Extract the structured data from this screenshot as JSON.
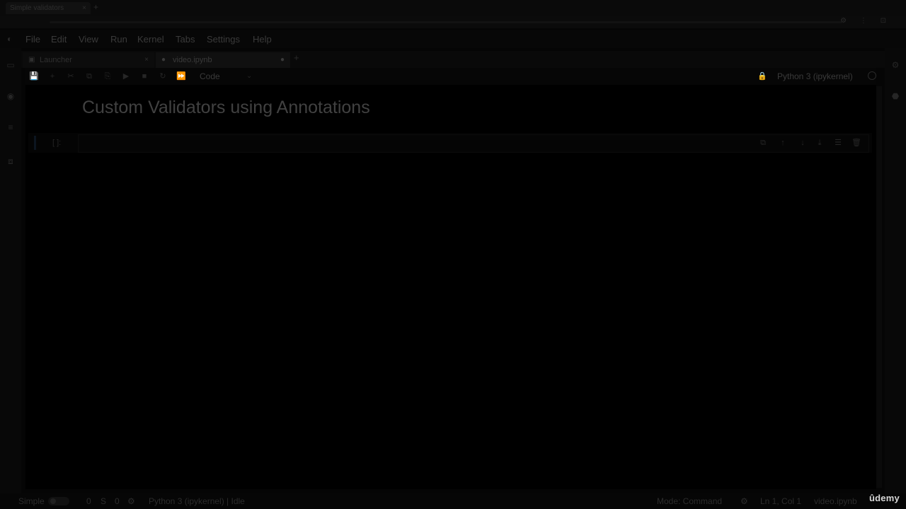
{
  "browser": {
    "tab_title": "Simple validators",
    "tab_close": "×",
    "new_tab": "+",
    "window_controls": "⚙ ⋮ ⊡"
  },
  "menubar": {
    "logo": "◐",
    "items": [
      "File",
      "Edit",
      "View",
      "Run",
      "Kernel",
      "Tabs",
      "Settings",
      "Help"
    ]
  },
  "doc_tabs": [
    {
      "label": "Launcher",
      "icon": "▣",
      "close": "×"
    },
    {
      "label": "video.ipynb",
      "icon": "●",
      "close": "●"
    }
  ],
  "doc_tab_add": "+",
  "toolbar": {
    "icons": [
      "💾",
      "+",
      "✂",
      "⧉",
      "⎘",
      "▶",
      "■",
      "↻",
      "⏩"
    ],
    "cell_type": "Code",
    "cell_type_chevron": "⌄",
    "kernel_lock": "🔒",
    "kernel_name": "Python 3 (ipykernel)"
  },
  "notebook": {
    "heading": "Custom Validators using Annotations",
    "cell_prompt": "[ ]:",
    "cell_tools": [
      "⧉",
      "↑",
      "↓",
      "⤓",
      "☰",
      "🗑"
    ]
  },
  "statusbar": {
    "mode_label": "Simple",
    "counts": [
      "0",
      "S",
      "0",
      "⚙"
    ],
    "kernel_status": "Python 3 (ipykernel) | Idle",
    "mode": "Mode: Command",
    "position": "Ln 1, Col 1",
    "file": "video.ipynb"
  },
  "branding": {
    "watermark": "ûdemy"
  }
}
